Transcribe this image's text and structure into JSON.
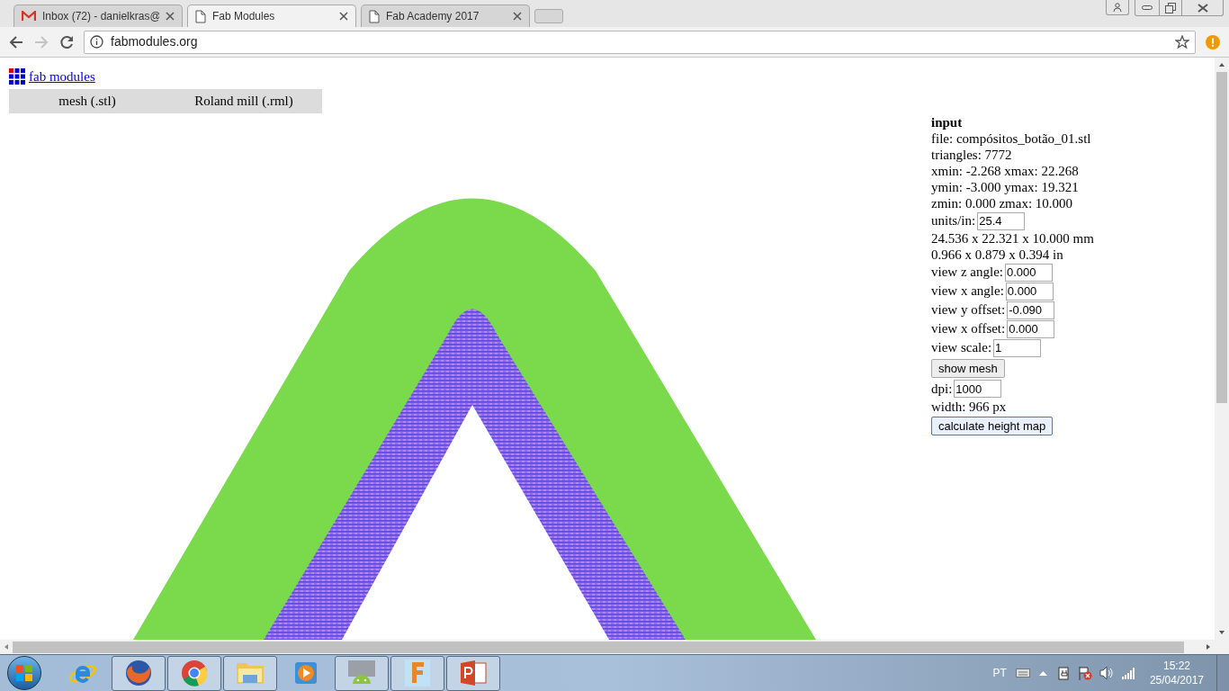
{
  "browser": {
    "tabs": [
      {
        "kind": "mail",
        "title": "Inbox (72) - danielkras@",
        "selected": false
      },
      {
        "kind": "page",
        "title": "Fab Modules",
        "selected": true
      },
      {
        "kind": "page",
        "title": "Fab Academy 2017",
        "selected": false
      }
    ],
    "url": "fabmodules.org"
  },
  "page": {
    "logo_link": "fab modules",
    "menu": [
      "mesh (.stl)",
      "Roland mill (.rml)"
    ],
    "panel": {
      "title": "input",
      "items": [
        {
          "kind": "text",
          "text": "file: compósitos_botão_01.stl"
        },
        {
          "kind": "text",
          "text": "triangles: 7772"
        },
        {
          "kind": "text",
          "text": "xmin: -2.268 xmax: 22.268"
        },
        {
          "kind": "text",
          "text": "ymin: -3.000 ymax: 19.321"
        },
        {
          "kind": "text",
          "text": "zmin: 0.000 zmax: 10.000"
        },
        {
          "kind": "field",
          "label": "units/in:",
          "value": "25.4"
        },
        {
          "kind": "text",
          "text": "24.536 x 22.321 x 10.000 mm"
        },
        {
          "kind": "text",
          "text": "0.966 x 0.879 x 0.394 in"
        },
        {
          "kind": "field",
          "label": "view z angle:",
          "value": "0.000"
        },
        {
          "kind": "field",
          "label": "view x angle:",
          "value": "0.000"
        },
        {
          "kind": "field",
          "label": "view y offset:",
          "value": "-0.090"
        },
        {
          "kind": "field",
          "label": "view x offset:",
          "value": "0.000"
        },
        {
          "kind": "field",
          "label": "view scale:",
          "value": "1"
        },
        {
          "kind": "button",
          "label": "show mesh",
          "focused": false
        },
        {
          "kind": "field",
          "label": "dpi:",
          "value": "1000"
        },
        {
          "kind": "text",
          "text": "width: 966 px"
        },
        {
          "kind": "button",
          "label": "calculate height map",
          "focused": true
        }
      ]
    }
  },
  "taskbar": {
    "apps": [
      {
        "kind": "ie",
        "running": false
      },
      {
        "kind": "firefox",
        "running": true
      },
      {
        "kind": "chrome",
        "running": true
      },
      {
        "kind": "explorer",
        "running": true
      },
      {
        "kind": "media",
        "running": false
      },
      {
        "kind": "android",
        "running": true
      },
      {
        "kind": "fusion",
        "running": true
      },
      {
        "kind": "powerpoint",
        "running": true
      }
    ],
    "language": "PT",
    "time": "15:22",
    "date": "25/04/2017"
  }
}
